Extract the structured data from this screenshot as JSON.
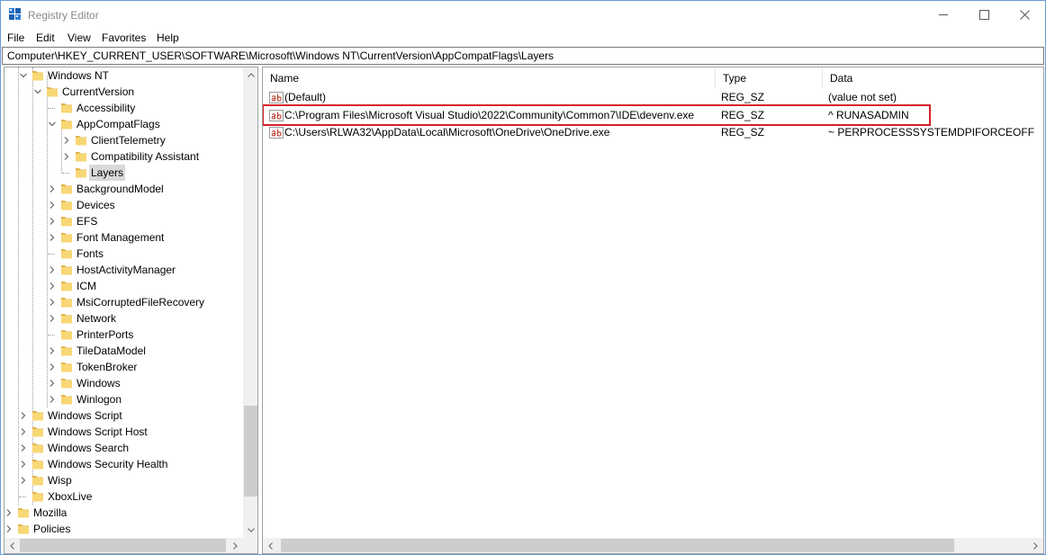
{
  "window": {
    "title": "Registry Editor"
  },
  "menu": [
    "File",
    "Edit",
    "View",
    "Favorites",
    "Help"
  ],
  "address": "Computer\\HKEY_CURRENT_USER\\SOFTWARE\\Microsoft\\Windows NT\\CurrentVersion\\AppCompatFlags\\Layers",
  "tree": [
    {
      "label": "Windows NT",
      "level": 2,
      "expanded": true
    },
    {
      "label": "CurrentVersion",
      "level": 3,
      "expanded": true
    },
    {
      "label": "Accessibility",
      "level": 4,
      "expanded": null
    },
    {
      "label": "AppCompatFlags",
      "level": 4,
      "expanded": true
    },
    {
      "label": "ClientTelemetry",
      "level": 5,
      "expanded": false
    },
    {
      "label": "Compatibility Assistant",
      "level": 5,
      "expanded": false
    },
    {
      "label": "Layers",
      "level": 5,
      "expanded": null,
      "selected": true
    },
    {
      "label": "BackgroundModel",
      "level": 4,
      "expanded": false
    },
    {
      "label": "Devices",
      "level": 4,
      "expanded": false
    },
    {
      "label": "EFS",
      "level": 4,
      "expanded": false
    },
    {
      "label": "Font Management",
      "level": 4,
      "expanded": false
    },
    {
      "label": "Fonts",
      "level": 4,
      "expanded": null
    },
    {
      "label": "HostActivityManager",
      "level": 4,
      "expanded": false
    },
    {
      "label": "ICM",
      "level": 4,
      "expanded": false
    },
    {
      "label": "MsiCorruptedFileRecovery",
      "level": 4,
      "expanded": false
    },
    {
      "label": "Network",
      "level": 4,
      "expanded": false
    },
    {
      "label": "PrinterPorts",
      "level": 4,
      "expanded": null
    },
    {
      "label": "TileDataModel",
      "level": 4,
      "expanded": false
    },
    {
      "label": "TokenBroker",
      "level": 4,
      "expanded": false
    },
    {
      "label": "Windows",
      "level": 4,
      "expanded": false
    },
    {
      "label": "Winlogon",
      "level": 4,
      "expanded": false
    },
    {
      "label": "Windows Script",
      "level": 2,
      "expanded": false
    },
    {
      "label": "Windows Script Host",
      "level": 2,
      "expanded": false
    },
    {
      "label": "Windows Search",
      "level": 2,
      "expanded": false
    },
    {
      "label": "Windows Security Health",
      "level": 2,
      "expanded": false
    },
    {
      "label": "Wisp",
      "level": 2,
      "expanded": false
    },
    {
      "label": "XboxLive",
      "level": 2,
      "expanded": null
    },
    {
      "label": "Mozilla",
      "level": 1,
      "expanded": false
    },
    {
      "label": "Policies",
      "level": 1,
      "expanded": false
    }
  ],
  "list": {
    "headers": {
      "name": "Name",
      "type": "Type",
      "data": "Data"
    },
    "rows": [
      {
        "name": "(Default)",
        "type": "REG_SZ",
        "data": "(value not set)"
      },
      {
        "name": "C:\\Program Files\\Microsoft Visual Studio\\2022\\Community\\Common7\\IDE\\devenv.exe",
        "type": "REG_SZ",
        "data": "^ RUNASADMIN",
        "highlighted": true
      },
      {
        "name": "C:\\Users\\RLWA32\\AppData\\Local\\Microsoft\\OneDrive\\OneDrive.exe",
        "type": "REG_SZ",
        "data": "~ PERPROCESSSYSTEMDPIFORCEOFF"
      }
    ]
  },
  "icons": {
    "app": "registry-editor-icon",
    "folder": "folder-icon",
    "value": "string-value-icon",
    "chevron_right": "chevron-right-icon",
    "chevron_down": "chevron-down-icon"
  },
  "colors": {
    "folder": "#f8d775",
    "folder_edge": "#e0b54a",
    "highlight": "#d6202a",
    "selection": "#d9d9d9",
    "ab_red": "#c0392b"
  }
}
